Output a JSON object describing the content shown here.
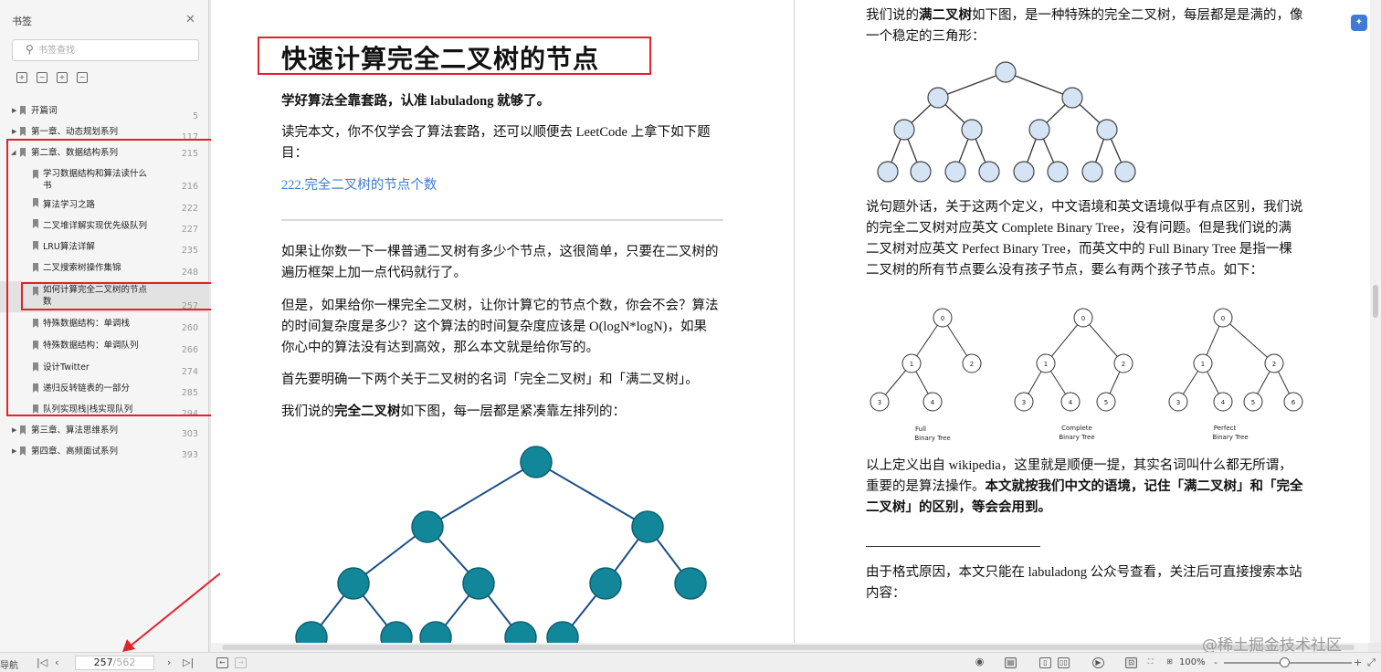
{
  "sidebar": {
    "title": "书签",
    "search_placeholder": "书签查找",
    "items": [
      {
        "label": "开篇词",
        "page": "5"
      },
      {
        "label": "第一章、动态规划系列",
        "page": "117"
      },
      {
        "label": "第二章、数据结构系列",
        "page": "215"
      },
      {
        "label": "学习数据结构和算法读什么",
        "label2": "书",
        "page": "216"
      },
      {
        "label": "算法学习之路",
        "page": "222"
      },
      {
        "label": "二叉堆详解实现优先级队列",
        "page": "227"
      },
      {
        "label": "LRU算法详解",
        "page": "235"
      },
      {
        "label": "二叉搜索树操作集锦",
        "page": "248"
      },
      {
        "label": "如何计算完全二叉树的节点",
        "label2": "数",
        "page": "257"
      },
      {
        "label": "特殊数据结构：单调栈",
        "page": "260"
      },
      {
        "label": "特殊数据结构：单调队列",
        "page": "266"
      },
      {
        "label": "设计Twitter",
        "page": "274"
      },
      {
        "label": "递归反转链表的一部分",
        "page": "285"
      },
      {
        "label": "队列实现栈|栈实现队列",
        "page": "294"
      },
      {
        "label": "第三章、算法思维系列",
        "page": "303"
      },
      {
        "label": "第四章、高频面试系列",
        "page": "393"
      }
    ]
  },
  "doc": {
    "title": "快速计算完全二叉树的节点",
    "intro_bold": "学好算法全靠套路，认准 labuladong 就够了。",
    "p1": "读完本文，你不仅学会了算法套路，还可以顺便去 LeetCode 上拿下如下题",
    "p1b": "目：",
    "link": "222.完全二叉树的节点个数",
    "p2a": "如果让你数一下一棵普通二叉树有多少个节点，这很简单，只要在二叉树的",
    "p2b": "遍历框架上加一点代码就行了。",
    "p3a": "但是，如果给你一棵完全二叉树，让你计算它的节点个数，你会不会？算法",
    "p3b": "的时间复杂度是多少？这个算法的时间复杂度应该是 O(logN*logN)，如果",
    "p3c": "你心中的算法没有达到高效，那么本文就是给你写的。",
    "p4": "首先要明确一下两个关于二叉树的名词「完全二叉树」和「满二叉树」。",
    "p5_pre": "我们说的",
    "p5_bold": "完全二叉树",
    "p5_post": "如下图，每一层都是紧凑靠左排列的：",
    "r1_pre": "我们说的",
    "r1_bold": "满二叉树",
    "r1_post": "如下图，是一种特殊的完全二叉树，每层都是是满的，像",
    "r1b": "一个稳定的三角形：",
    "r2a": "说句题外话，关于这两个定义，中文语境和英文语境似乎有点区别，我们说",
    "r2b": "的完全二叉树对应英文 Complete Binary Tree，没有问题。但是我们说的满",
    "r2c": "二叉树对应英文 Perfect Binary Tree，而英文中的 Full Binary Tree 是指一棵",
    "r2d": "二叉树的所有节点要么没有孩子节点，要么有两个孩子节点。如下：",
    "r3a": "以上定义出自 wikipedia，这里就是顺便一提，其实名词叫什么都无所谓，",
    "r3b_pre": "重要的是算法操作。",
    "r3b_bold": "本文就按我们中文的语境，记住「满二叉树」和「完全",
    "r3c_bold": "二叉树」的区别，等会会用到。",
    "r4a": "由于格式原因，本文只能在 labuladong 公众号查看，关注后可直接搜索本站",
    "r4b": "内容：",
    "fig": {
      "full_a": "Full",
      "full_b": "Binary Tree",
      "complete_a": "Complete",
      "complete_b": "Binary Tree",
      "perfect_a": "Perfect",
      "perfect_b": "Binary Tree",
      "n0": "0",
      "n1": "1",
      "n2": "2",
      "n3": "3",
      "n4": "4",
      "n5": "5",
      "n6": "6"
    }
  },
  "status": {
    "left_text": "导航",
    "page_current": "257",
    "page_total": "/562",
    "zoom": "100%",
    "zoom_minus": "-",
    "zoom_plus": "+"
  },
  "watermark": "@稀土掘金技术社区",
  "colors": {
    "highlight_red": "#e3222a",
    "tree_teal": "#13879a",
    "tree_light_blue": "#d4e4f5",
    "link_blue": "#3a7bd5"
  }
}
